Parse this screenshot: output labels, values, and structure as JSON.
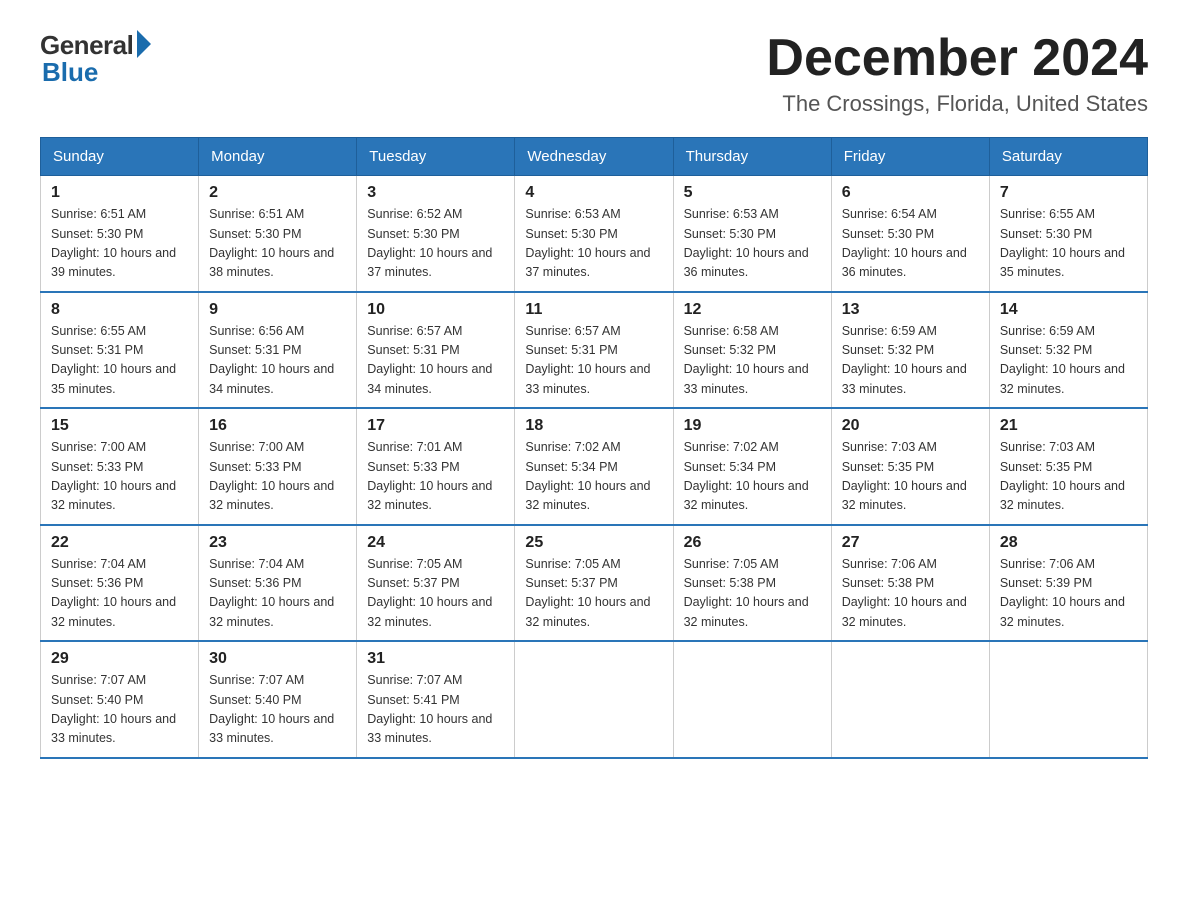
{
  "header": {
    "logo_general": "General",
    "logo_blue": "Blue",
    "month_title": "December 2024",
    "location": "The Crossings, Florida, United States"
  },
  "days_of_week": [
    "Sunday",
    "Monday",
    "Tuesday",
    "Wednesday",
    "Thursday",
    "Friday",
    "Saturday"
  ],
  "weeks": [
    [
      {
        "day": "1",
        "sunrise": "6:51 AM",
        "sunset": "5:30 PM",
        "daylight": "10 hours and 39 minutes."
      },
      {
        "day": "2",
        "sunrise": "6:51 AM",
        "sunset": "5:30 PM",
        "daylight": "10 hours and 38 minutes."
      },
      {
        "day": "3",
        "sunrise": "6:52 AM",
        "sunset": "5:30 PM",
        "daylight": "10 hours and 37 minutes."
      },
      {
        "day": "4",
        "sunrise": "6:53 AM",
        "sunset": "5:30 PM",
        "daylight": "10 hours and 37 minutes."
      },
      {
        "day": "5",
        "sunrise": "6:53 AM",
        "sunset": "5:30 PM",
        "daylight": "10 hours and 36 minutes."
      },
      {
        "day": "6",
        "sunrise": "6:54 AM",
        "sunset": "5:30 PM",
        "daylight": "10 hours and 36 minutes."
      },
      {
        "day": "7",
        "sunrise": "6:55 AM",
        "sunset": "5:30 PM",
        "daylight": "10 hours and 35 minutes."
      }
    ],
    [
      {
        "day": "8",
        "sunrise": "6:55 AM",
        "sunset": "5:31 PM",
        "daylight": "10 hours and 35 minutes."
      },
      {
        "day": "9",
        "sunrise": "6:56 AM",
        "sunset": "5:31 PM",
        "daylight": "10 hours and 34 minutes."
      },
      {
        "day": "10",
        "sunrise": "6:57 AM",
        "sunset": "5:31 PM",
        "daylight": "10 hours and 34 minutes."
      },
      {
        "day": "11",
        "sunrise": "6:57 AM",
        "sunset": "5:31 PM",
        "daylight": "10 hours and 33 minutes."
      },
      {
        "day": "12",
        "sunrise": "6:58 AM",
        "sunset": "5:32 PM",
        "daylight": "10 hours and 33 minutes."
      },
      {
        "day": "13",
        "sunrise": "6:59 AM",
        "sunset": "5:32 PM",
        "daylight": "10 hours and 33 minutes."
      },
      {
        "day": "14",
        "sunrise": "6:59 AM",
        "sunset": "5:32 PM",
        "daylight": "10 hours and 32 minutes."
      }
    ],
    [
      {
        "day": "15",
        "sunrise": "7:00 AM",
        "sunset": "5:33 PM",
        "daylight": "10 hours and 32 minutes."
      },
      {
        "day": "16",
        "sunrise": "7:00 AM",
        "sunset": "5:33 PM",
        "daylight": "10 hours and 32 minutes."
      },
      {
        "day": "17",
        "sunrise": "7:01 AM",
        "sunset": "5:33 PM",
        "daylight": "10 hours and 32 minutes."
      },
      {
        "day": "18",
        "sunrise": "7:02 AM",
        "sunset": "5:34 PM",
        "daylight": "10 hours and 32 minutes."
      },
      {
        "day": "19",
        "sunrise": "7:02 AM",
        "sunset": "5:34 PM",
        "daylight": "10 hours and 32 minutes."
      },
      {
        "day": "20",
        "sunrise": "7:03 AM",
        "sunset": "5:35 PM",
        "daylight": "10 hours and 32 minutes."
      },
      {
        "day": "21",
        "sunrise": "7:03 AM",
        "sunset": "5:35 PM",
        "daylight": "10 hours and 32 minutes."
      }
    ],
    [
      {
        "day": "22",
        "sunrise": "7:04 AM",
        "sunset": "5:36 PM",
        "daylight": "10 hours and 32 minutes."
      },
      {
        "day": "23",
        "sunrise": "7:04 AM",
        "sunset": "5:36 PM",
        "daylight": "10 hours and 32 minutes."
      },
      {
        "day": "24",
        "sunrise": "7:05 AM",
        "sunset": "5:37 PM",
        "daylight": "10 hours and 32 minutes."
      },
      {
        "day": "25",
        "sunrise": "7:05 AM",
        "sunset": "5:37 PM",
        "daylight": "10 hours and 32 minutes."
      },
      {
        "day": "26",
        "sunrise": "7:05 AM",
        "sunset": "5:38 PM",
        "daylight": "10 hours and 32 minutes."
      },
      {
        "day": "27",
        "sunrise": "7:06 AM",
        "sunset": "5:38 PM",
        "daylight": "10 hours and 32 minutes."
      },
      {
        "day": "28",
        "sunrise": "7:06 AM",
        "sunset": "5:39 PM",
        "daylight": "10 hours and 32 minutes."
      }
    ],
    [
      {
        "day": "29",
        "sunrise": "7:07 AM",
        "sunset": "5:40 PM",
        "daylight": "10 hours and 33 minutes."
      },
      {
        "day": "30",
        "sunrise": "7:07 AM",
        "sunset": "5:40 PM",
        "daylight": "10 hours and 33 minutes."
      },
      {
        "day": "31",
        "sunrise": "7:07 AM",
        "sunset": "5:41 PM",
        "daylight": "10 hours and 33 minutes."
      },
      null,
      null,
      null,
      null
    ]
  ]
}
